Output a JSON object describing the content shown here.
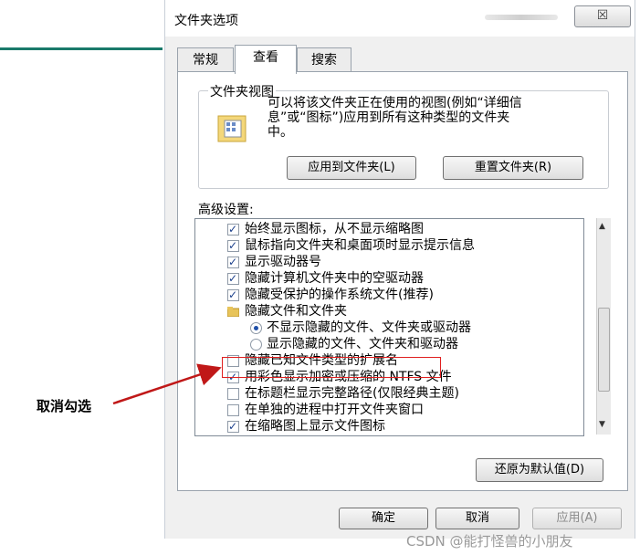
{
  "dialog": {
    "title": "文件夹选项",
    "close_glyph": "☒"
  },
  "tabs": [
    {
      "label": "常规",
      "active": false
    },
    {
      "label": "查看",
      "active": true
    },
    {
      "label": "搜索",
      "active": false
    }
  ],
  "folder_views": {
    "legend": "文件夹视图",
    "description": [
      "可以将该文件夹正在使用的视图(例如“详细信",
      "息”或“图标”)应用到所有这种类型的文件夹",
      "中。"
    ],
    "apply_button": "应用到文件夹(L)",
    "reset_button": "重置文件夹(R)"
  },
  "advanced": {
    "label": "高级设置:",
    "items": [
      {
        "type": "checkbox",
        "checked": true,
        "label": "始终显示图标，从不显示缩略图"
      },
      {
        "type": "checkbox",
        "checked": true,
        "label": "鼠标指向文件夹和桌面项时显示提示信息"
      },
      {
        "type": "checkbox",
        "checked": true,
        "label": "显示驱动器号"
      },
      {
        "type": "checkbox",
        "checked": true,
        "label": "隐藏计算机文件夹中的空驱动器"
      },
      {
        "type": "checkbox",
        "checked": true,
        "label": "隐藏受保护的操作系统文件(推荐)"
      },
      {
        "type": "folder",
        "checked": false,
        "label": "隐藏文件和文件夹"
      },
      {
        "type": "radio",
        "checked": true,
        "label": "不显示隐藏的文件、文件夹或驱动器"
      },
      {
        "type": "radio",
        "checked": false,
        "label": "显示隐藏的文件、文件夹和驱动器"
      },
      {
        "type": "checkbox",
        "checked": false,
        "label": "隐藏已知文件类型的扩展名"
      },
      {
        "type": "checkbox",
        "checked": true,
        "label": "用彩色显示加密或压缩的 NTFS 文件"
      },
      {
        "type": "checkbox",
        "checked": false,
        "label": "在标题栏显示完整路径(仅限经典主题)"
      },
      {
        "type": "checkbox",
        "checked": false,
        "label": "在单独的进程中打开文件夹窗口"
      },
      {
        "type": "checkbox",
        "checked": true,
        "label": "在缩略图上显示文件图标"
      }
    ],
    "restore_button": "还原为默认值(D)"
  },
  "footer": {
    "ok": "确定",
    "cancel": "取消",
    "apply": "应用(A)"
  },
  "annotation": "取消勾选",
  "watermark": "CSDN @能打怪兽的小朋友",
  "colors": {
    "highlight": "#e02020",
    "arrow": "#c01818",
    "accent_line": "#1a7a6a"
  }
}
